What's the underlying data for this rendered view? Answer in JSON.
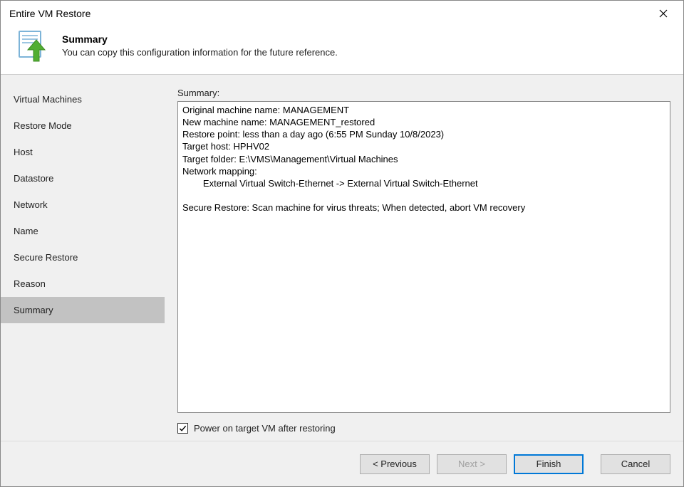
{
  "titlebar": {
    "title": "Entire VM Restore"
  },
  "header": {
    "heading": "Summary",
    "subheading": "You can copy this configuration information for the future reference."
  },
  "sidebar": {
    "items": [
      {
        "label": "Virtual Machines"
      },
      {
        "label": "Restore Mode"
      },
      {
        "label": "Host"
      },
      {
        "label": "Datastore"
      },
      {
        "label": "Network"
      },
      {
        "label": "Name"
      },
      {
        "label": "Secure Restore"
      },
      {
        "label": "Reason"
      },
      {
        "label": "Summary"
      }
    ],
    "active_index": 8
  },
  "main": {
    "summary_label": "Summary:",
    "summary_text": "Original machine name: MANAGEMENT\nNew machine name: MANAGEMENT_restored\nRestore point: less than a day ago (6:55 PM Sunday 10/8/2023)\nTarget host: HPHV02\nTarget folder: E:\\VMS\\Management\\Virtual Machines\nNetwork mapping:\n        External Virtual Switch-Ethernet -> External Virtual Switch-Ethernet\n\nSecure Restore: Scan machine for virus threats; When detected, abort VM recovery",
    "checkbox": {
      "checked": true,
      "label": "Power on target VM after restoring"
    }
  },
  "footer": {
    "previous": "< Previous",
    "next": "Next >",
    "finish": "Finish",
    "cancel": "Cancel"
  }
}
